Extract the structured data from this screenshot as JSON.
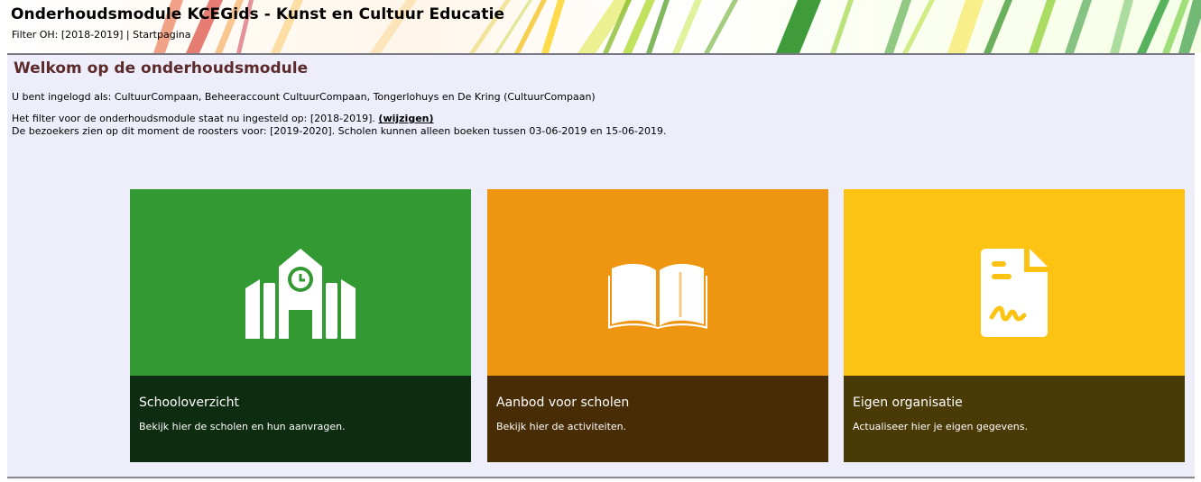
{
  "header": {
    "title": "Onderhoudsmodule KCEGids - Kunst en Cultuur Educatie",
    "crumbs": {
      "filter_text": "Filter OH: [2018-2019]",
      "separator": " | ",
      "startpage": "Startpagina"
    }
  },
  "main": {
    "title": "Welkom op de onderhoudsmodule",
    "logged_in": "U bent ingelogd als: CultuurCompaan, Beheeraccount CultuurCompaan, Tongerlohuys en De Kring (CultuurCompaan)",
    "filter_line": "Het filter voor de onderhoudsmodule staat nu ingesteld op: [2018-2019].",
    "filter_link": "(wijzigen)",
    "visitors_line": "De bezoekers zien op dit moment de roosters voor: [2019-2020]. Scholen kunnen alleen boeken tussen 03-06-2019 en 15-06-2019."
  },
  "tiles": [
    {
      "title": "Schooloverzicht",
      "subtitle": "Bekijk hier de scholen en hun aanvragen.",
      "icon": "school-icon",
      "color_top": "#339933",
      "color_bottom": "#0e2d10"
    },
    {
      "title": "Aanbod voor scholen",
      "subtitle": "Bekijk hier de activiteiten.",
      "icon": "open-book-icon",
      "color_top": "#ee9511",
      "color_bottom": "#482c06"
    },
    {
      "title": "Eigen organisatie",
      "subtitle": "Actualiseer hier je eigen gegevens.",
      "icon": "signed-document-icon",
      "color_top": "#fdc313",
      "color_bottom": "#4a3a06"
    }
  ],
  "colors": {
    "main_background": "#eeeefb",
    "page_title": "#5c2a2a"
  }
}
